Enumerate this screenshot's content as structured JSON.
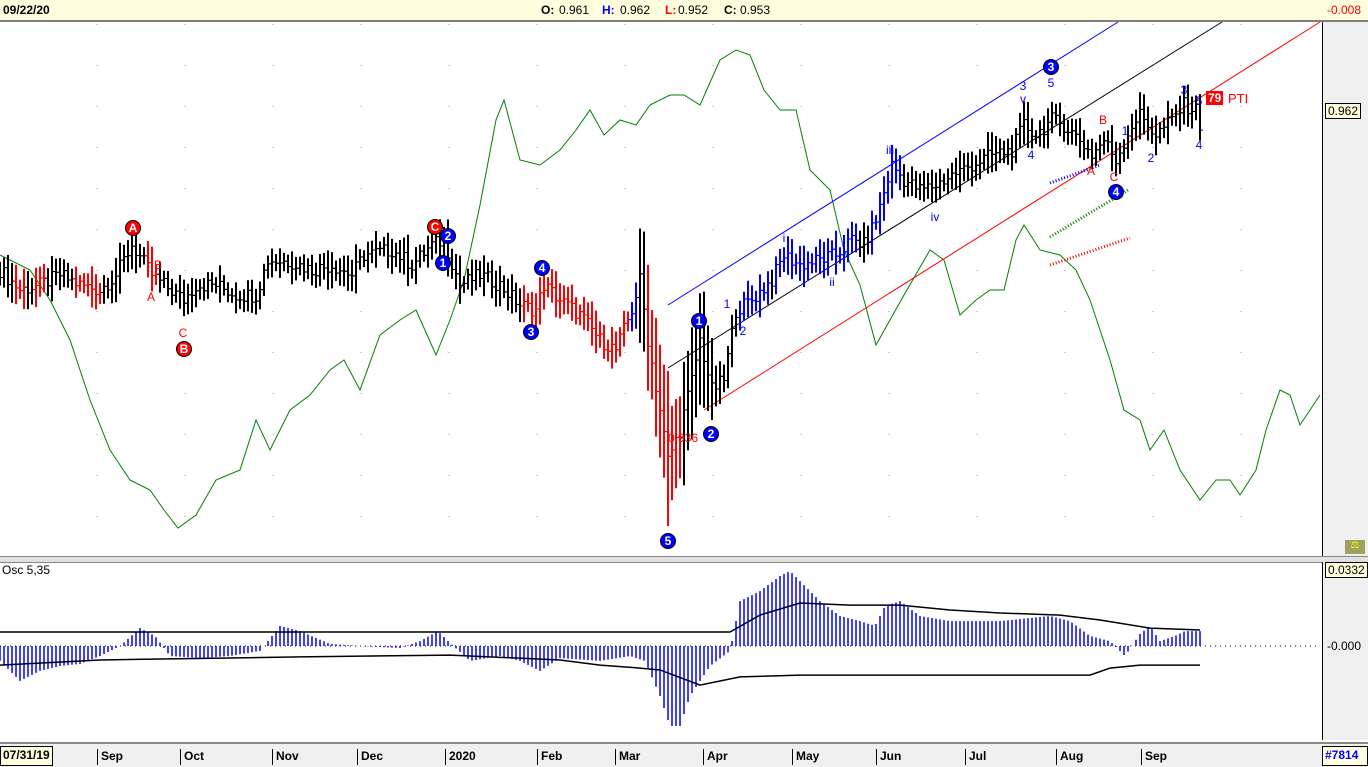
{
  "header": {
    "date": "09/22/20",
    "open_label": "O:",
    "open": "0.961",
    "high_label": "H:",
    "high": "0.962",
    "low_label": "L:",
    "low": "0.952",
    "close_label": "C:",
    "close": "0.953",
    "change": "-0.008"
  },
  "price_tag": "0.962",
  "osc": {
    "label": "Osc 5,35",
    "top_tag": "0.0332",
    "zero_tag": "-0.000"
  },
  "footer": {
    "start_date": "07/31/19",
    "id": "#7814"
  },
  "pti": {
    "value": "79",
    "label": "PTI"
  },
  "colors": {
    "up": "#000000",
    "red": "#ff0000",
    "blue": "#0000ff",
    "green": "#008000"
  },
  "chart_data": {
    "type": "ohlc",
    "x_ticks": [
      "Sep",
      "Oct",
      "Nov",
      "Dec",
      "2020",
      "Feb",
      "Mar",
      "Apr",
      "May",
      "Jun",
      "Jul",
      "Aug",
      "Sep"
    ],
    "close_keypoints": {
      "day": [
        0,
        5,
        10,
        15,
        20,
        25,
        29,
        33,
        38,
        41,
        46,
        49,
        54,
        59,
        64,
        67,
        73,
        78,
        83,
        88,
        91,
        98,
        103,
        108,
        111,
        115,
        120,
        125,
        130,
        134,
        136,
        140,
        145,
        150,
        154,
        158,
        160,
        162,
        165,
        167,
        170,
        173,
        175,
        178,
        181,
        184,
        188,
        193,
        196,
        200,
        205,
        209,
        213,
        216,
        219,
        223,
        226,
        230,
        234,
        238,
        243,
        248,
        253,
        256,
        259,
        263,
        266,
        270,
        273,
        276,
        279,
        283,
        285,
        289,
        293,
        296,
        299,
        300
      ],
      "price": [
        0.9302,
        0.9262,
        0.9272,
        0.9292,
        0.9272,
        0.9262,
        0.9292,
        0.9352,
        0.9292,
        0.9272,
        0.9242,
        0.9272,
        0.9272,
        0.9252,
        0.9252,
        0.9322,
        0.9318,
        0.9302,
        0.9312,
        0.9292,
        0.9332,
        0.9342,
        0.9312,
        0.9352,
        0.9362,
        0.9272,
        0.9292,
        0.9272,
        0.9232,
        0.9222,
        0.9272,
        0.9242,
        0.9212,
        0.9162,
        0.9142,
        0.9222,
        0.9282,
        0.9162,
        0.9022,
        0.8922,
        0.8982,
        0.9082,
        0.9162,
        0.9062,
        0.9082,
        0.9222,
        0.9242,
        0.9282,
        0.9332,
        0.9312,
        0.9322,
        0.9332,
        0.9362,
        0.9352,
        0.9402,
        0.9512,
        0.9482,
        0.9462,
        0.9472,
        0.9492,
        0.9512,
        0.9532,
        0.9542,
        0.9592,
        0.9572,
        0.9602,
        0.9592,
        0.9562,
        0.9532,
        0.9562,
        0.9522,
        0.9592,
        0.9612,
        0.9572,
        0.9602,
        0.9632,
        0.9622,
        0.9592
      ]
    },
    "red_day_ranges": [
      [
        4,
        6
      ],
      [
        9,
        11
      ],
      [
        19,
        25
      ],
      [
        37,
        39
      ],
      [
        131,
        157
      ],
      [
        162,
        170
      ]
    ],
    "blue_day_ranges": [
      [
        158,
        159
      ],
      [
        185,
        192
      ],
      [
        194,
        214
      ],
      [
        218,
        225
      ]
    ],
    "relative_strength": {
      "day": [
        0,
        7.5,
        12.5,
        17.5,
        22.5,
        27.5,
        32.5,
        37.5,
        41,
        44.5,
        49,
        54,
        60,
        64,
        67.5,
        72.5,
        77.5,
        82.5,
        86,
        90,
        95,
        100,
        104,
        109,
        112.5,
        116,
        120,
        124,
        126,
        130,
        135,
        140,
        144,
        147.5,
        151,
        155,
        159,
        162.5,
        167.5,
        171,
        175,
        180,
        184,
        187.5,
        191,
        195,
        199,
        202.5,
        207.5,
        211,
        215,
        219,
        222.5,
        226,
        232.5,
        236,
        240,
        244,
        247.5,
        251,
        254,
        256,
        260,
        265,
        269,
        272.5,
        277.5,
        281,
        285,
        287.5,
        291,
        295,
        300,
        304,
        307.5,
        310,
        314,
        316.5,
        320,
        322.5,
        325,
        330
      ],
      "values": [
        61,
        58,
        52,
        44,
        32,
        22,
        16,
        14,
        10,
        6.4,
        9,
        16,
        18,
        28,
        22,
        30,
        33,
        38,
        40,
        34,
        45,
        48,
        50,
        41,
        48,
        56,
        71,
        88,
        92,
        80,
        79,
        82,
        86,
        90,
        85,
        88,
        87,
        91,
        93,
        93,
        91,
        100,
        102,
        101,
        94,
        90,
        90,
        78,
        74,
        62,
        55,
        43,
        48,
        53,
        62,
        60,
        49,
        52,
        54,
        54,
        64,
        67,
        62,
        61,
        58,
        52,
        40,
        30,
        28,
        22,
        26,
        18,
        12,
        16,
        16,
        13,
        18,
        26,
        34,
        33,
        27,
        33
      ]
    },
    "channels": [
      {
        "color": "blue",
        "from": [
          167,
          0.9232
        ],
        "to": [
          279.5,
          0.9798
        ]
      },
      {
        "color": "black",
        "from": [
          167,
          0.9106
        ],
        "to": [
          305.5,
          0.9798
        ]
      },
      {
        "color": "red",
        "from": [
          176,
          0.9022
        ],
        "to": [
          330,
          0.9798
        ]
      }
    ],
    "projections": [
      {
        "color": "blue",
        "from": [
          262.5,
          0.9476
        ],
        "to": [
          275,
          0.9512
        ]
      },
      {
        "color": "green",
        "from": [
          262.5,
          0.9368
        ],
        "to": [
          282,
          0.9462
        ]
      },
      {
        "color": "red",
        "from": [
          262.5,
          0.9312
        ],
        "to": [
          282.5,
          0.9366
        ]
      }
    ],
    "wave_labels": [
      {
        "text": "A",
        "color": "red",
        "circled": true,
        "day": 33.25,
        "price": 0.9386
      },
      {
        "text": "B",
        "color": "red",
        "circled": false,
        "day": 39.5,
        "price": 0.9312
      },
      {
        "text": "A",
        "color": "red",
        "circled": false,
        "day": 37.75,
        "price": 0.9248
      },
      {
        "text": "C",
        "color": "red",
        "circled": false,
        "day": 45.75,
        "price": 0.9176
      },
      {
        "text": "B",
        "color": "red",
        "circled": true,
        "day": 46,
        "price": 0.9144
      },
      {
        "text": "C",
        "color": "red",
        "circled": true,
        "day": 108.75,
        "price": 0.9388
      },
      {
        "text": "2",
        "color": "blue",
        "circled": true,
        "day": 112,
        "price": 0.937
      },
      {
        "text": "1",
        "color": "blue",
        "circled": true,
        "day": 110.75,
        "price": 0.9316
      },
      {
        "text": "4",
        "color": "blue",
        "circled": true,
        "day": 135.5,
        "price": 0.9306
      },
      {
        "text": "3",
        "color": "blue",
        "circled": true,
        "day": 132.75,
        "price": 0.9178
      },
      {
        "text": "1",
        "color": "blue",
        "circled": true,
        "day": 174.75,
        "price": 0.92
      },
      {
        "text": "2",
        "color": "blue",
        "circled": false,
        "day": 185.75,
        "price": 0.918
      },
      {
        "text": "1",
        "color": "blue",
        "circled": false,
        "day": 181.75,
        "price": 0.9234
      },
      {
        "text": "2",
        "color": "blue",
        "circled": true,
        "day": 177.75,
        "price": 0.8974
      },
      {
        "text": "5",
        "color": "blue",
        "circled": true,
        "day": 167,
        "price": 0.876
      },
      {
        "text": "0.936",
        "color": "red",
        "circled": false,
        "day": 170.75,
        "price": 0.8966
      },
      {
        "text": "i",
        "color": "blue",
        "circled": false,
        "day": 196,
        "price": 0.9366
      },
      {
        "text": "ii",
        "color": "blue",
        "circled": false,
        "day": 208,
        "price": 0.9278
      },
      {
        "text": "iii",
        "color": "blue",
        "circled": false,
        "day": 222.5,
        "price": 0.9542
      },
      {
        "text": "iv",
        "color": "blue",
        "circled": false,
        "day": 233.75,
        "price": 0.9408
      },
      {
        "text": "v",
        "color": "blue",
        "circled": false,
        "day": 255.75,
        "price": 0.9644
      },
      {
        "text": "3",
        "color": "blue",
        "circled": false,
        "day": 255.75,
        "price": 0.967
      },
      {
        "text": "5",
        "color": "blue",
        "circled": false,
        "day": 262.75,
        "price": 0.9676
      },
      {
        "text": "3",
        "color": "blue",
        "circled": true,
        "day": 262.75,
        "price": 0.9708
      },
      {
        "text": "4",
        "color": "blue",
        "circled": false,
        "day": 257.75,
        "price": 0.9532
      },
      {
        "text": "B",
        "color": "red",
        "circled": false,
        "day": 275.75,
        "price": 0.9602
      },
      {
        "text": "A",
        "color": "red",
        "circled": false,
        "day": 272.75,
        "price": 0.95
      },
      {
        "text": "C",
        "color": "red",
        "circled": false,
        "day": 278.5,
        "price": 0.9488
      },
      {
        "text": "1",
        "color": "blue",
        "circled": false,
        "day": 281.25,
        "price": 0.958
      },
      {
        "text": "2",
        "color": "blue",
        "circled": false,
        "day": 287.75,
        "price": 0.9526
      },
      {
        "text": "4",
        "color": "blue",
        "circled": true,
        "day": 279,
        "price": 0.9458
      },
      {
        "text": "3",
        "color": "blue",
        "circled": false,
        "day": 296,
        "price": 0.9662
      },
      {
        "text": "5",
        "color": "blue",
        "circled": false,
        "day": 299.75,
        "price": 0.964
      },
      {
        "text": "4",
        "color": "blue",
        "circled": false,
        "day": 299.75,
        "price": 0.9552
      }
    ],
    "oscillator": {
      "day": [
        0,
        5,
        10,
        15,
        20,
        25,
        30,
        35,
        38.75,
        42.5,
        50,
        57.5,
        65,
        70,
        75,
        82.5,
        90,
        100,
        105,
        109.5,
        112.5,
        117.5,
        125,
        130,
        135,
        140,
        150,
        157.5,
        161.25,
        165,
        167.5,
        170,
        172.5,
        177.5,
        182.5,
        185,
        190,
        195,
        197.5,
        200,
        205,
        210,
        215,
        218.75,
        221.25,
        225,
        230,
        237.5,
        250,
        262.5,
        267.5,
        272.5,
        277.5,
        281.25,
        285,
        287.5,
        290,
        293.75,
        296.25,
        300
      ],
      "values": [
        -0.0064,
        -0.015,
        -0.0107,
        -0.0086,
        -0.0077,
        -0.0043,
        0,
        0.0077,
        0.0043,
        -0.0043,
        -0.0052,
        -0.0043,
        -0.0021,
        0.0086,
        0.0064,
        0.0009,
        0,
        -0.0009,
        0.0021,
        0.0064,
        0.0013,
        -0.0064,
        -0.0043,
        -0.0064,
        -0.0107,
        -0.0052,
        -0.0064,
        -0.0043,
        -0.0064,
        -0.0215,
        -0.0344,
        -0.0344,
        -0.0215,
        -0.0086,
        -0.0021,
        0.0193,
        0.0236,
        0.0301,
        0.0322,
        0.0279,
        0.0193,
        0.0129,
        0.0107,
        0.0086,
        0.0172,
        0.0193,
        0.0129,
        0.0107,
        0.0107,
        0.0129,
        0.0107,
        0.0043,
        0.0021,
        -0.0043,
        0.0052,
        0.0086,
        0.0021,
        0.0043,
        0.0064,
        0.0064
      ],
      "upper_band": {
        "day": [
          0,
          182.5,
          190,
          200,
          212.5,
          225,
          237.5,
          250,
          265,
          275,
          287.5,
          300
        ],
        "values": [
          0.006,
          0.006,
          0.0133,
          0.0185,
          0.0176,
          0.0176,
          0.0155,
          0.0142,
          0.0133,
          0.0112,
          0.0077,
          0.0069
        ]
      },
      "lower_band": {
        "day": [
          0,
          25,
          75,
          112.5,
          140,
          150,
          160,
          165,
          175,
          185,
          200,
          272.5,
          277.5,
          285,
          300
        ],
        "values": [
          -0.0082,
          -0.006,
          -0.0047,
          -0.0039,
          -0.006,
          -0.0082,
          -0.0095,
          -0.0103,
          -0.0168,
          -0.0133,
          -0.0125,
          -0.0125,
          -0.0095,
          -0.0082,
          -0.0082
        ]
      },
      "ylim_top": 0.0332
    }
  }
}
